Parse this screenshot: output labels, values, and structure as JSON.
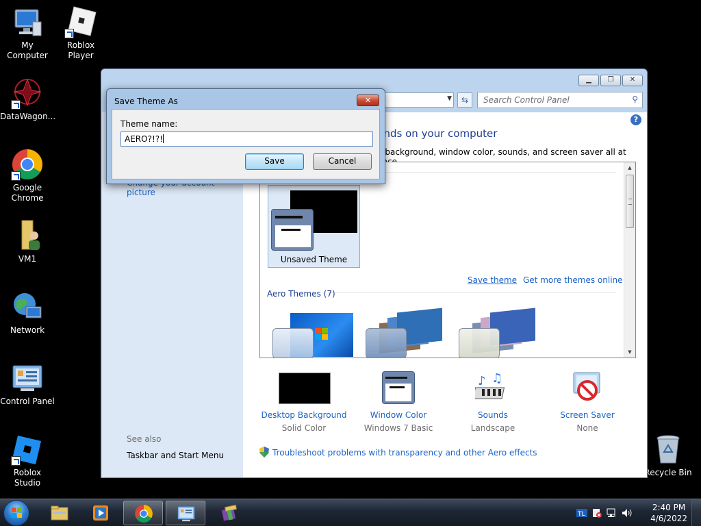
{
  "desktop": {
    "icons": [
      {
        "label": "My Computer"
      },
      {
        "label": "Roblox Player"
      },
      {
        "label": "DataWagon..."
      },
      {
        "label": "Google Chrome"
      },
      {
        "label": "VM1"
      },
      {
        "label": "Network"
      },
      {
        "label": "Control Panel"
      },
      {
        "label": "Roblox Studio"
      },
      {
        "label": "Recycle Bin"
      }
    ]
  },
  "control_panel": {
    "search_placeholder": "Search Control Panel",
    "heading": "unds on your computer",
    "subheading": "p background, window color, sounds, and screen saver all at once.",
    "left_link": "Change your account picture",
    "see_also": "See also",
    "taskbar_link": "Taskbar and Start Menu",
    "unsaved_theme": "Unsaved Theme",
    "save_theme": "Save theme",
    "more_themes": "Get more themes online",
    "aero_themes": "Aero Themes (7)",
    "bottom": [
      {
        "label": "Desktop Background",
        "value": "Solid Color"
      },
      {
        "label": "Window Color",
        "value": "Windows 7 Basic"
      },
      {
        "label": "Sounds",
        "value": "Landscape"
      },
      {
        "label": "Screen Saver",
        "value": "None"
      }
    ],
    "troubleshoot": "Troubleshoot problems with transparency and other Aero effects"
  },
  "dialog": {
    "title": "Save Theme As",
    "label": "Theme name:",
    "value": "AERO?!?!",
    "save": "Save",
    "cancel": "Cancel"
  },
  "taskbar": {
    "time": "2:40 PM",
    "date": "4/6/2022"
  },
  "colors": {
    "accent_link": "#1a63c8",
    "heading": "#1e3d8f",
    "close_button": "#c74a35"
  }
}
